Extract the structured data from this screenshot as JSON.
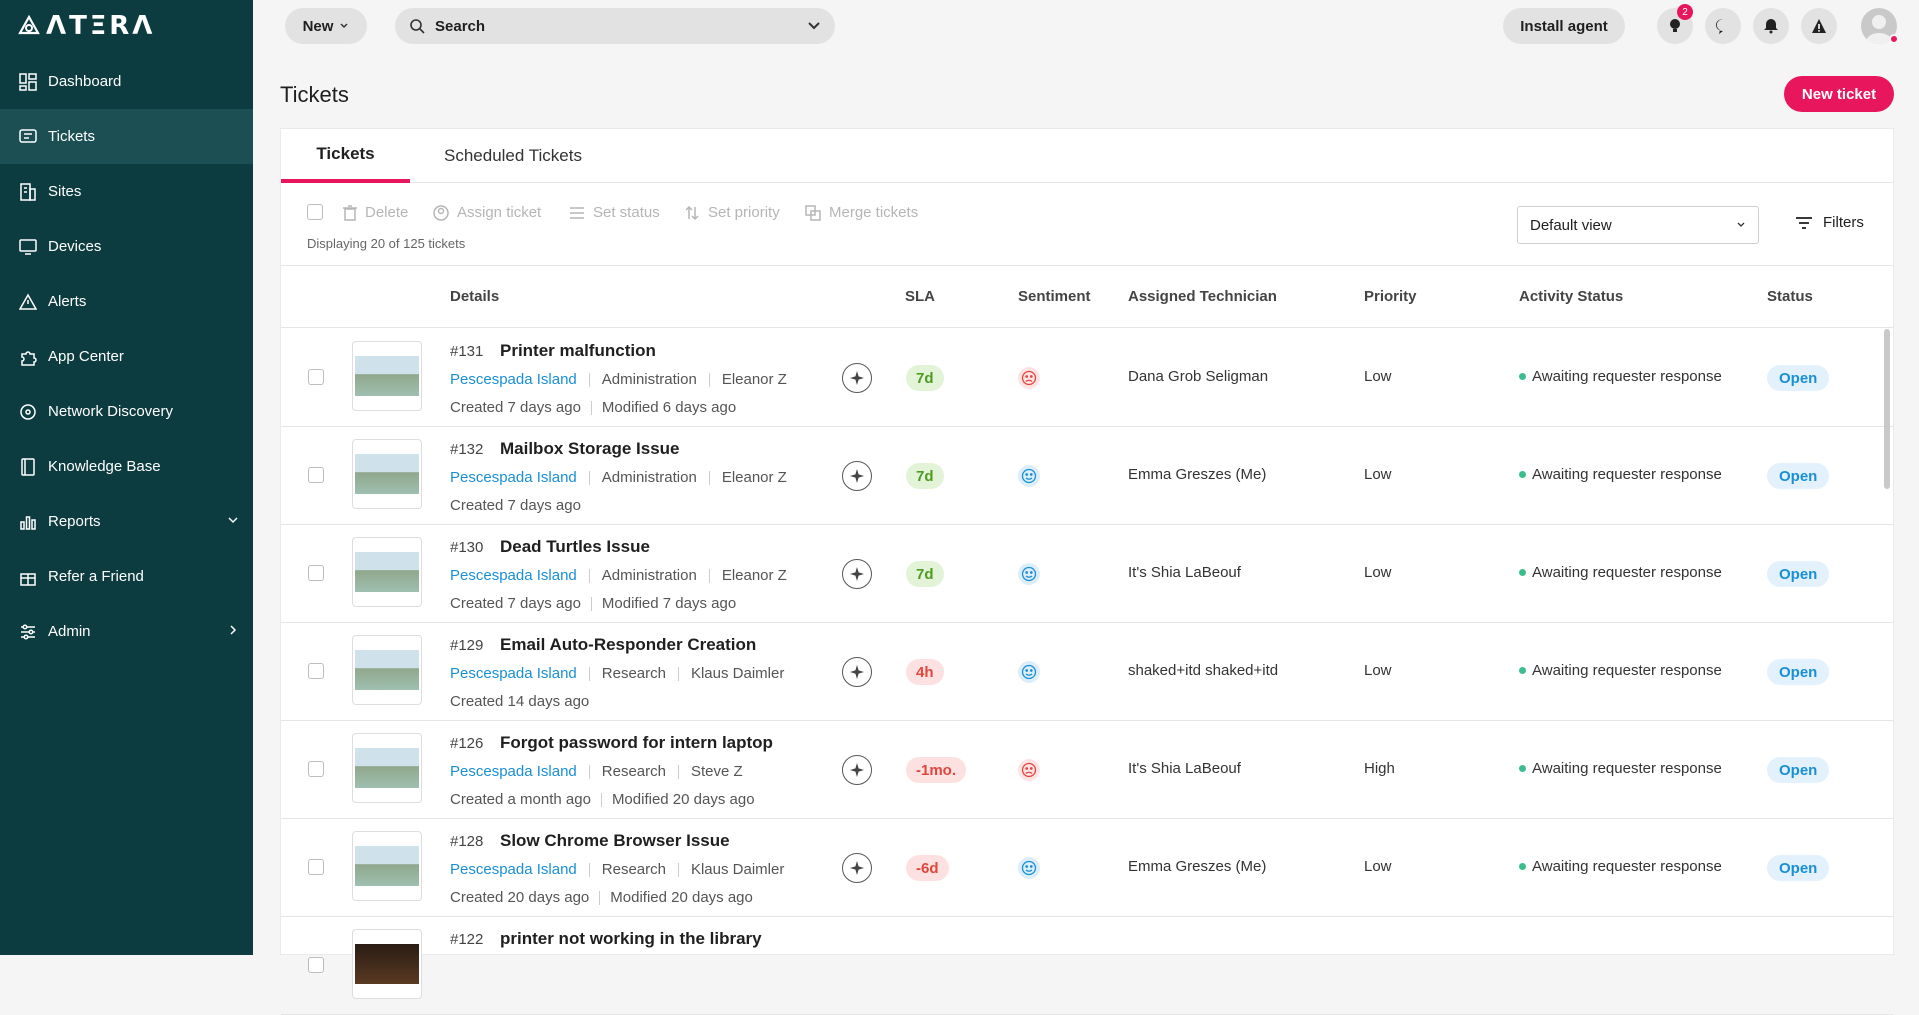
{
  "app": {
    "logo_text": "ΛΤΞRΛ"
  },
  "sidebar": {
    "items": [
      {
        "label": "Dashboard",
        "icon": "dashboard-icon"
      },
      {
        "label": "Tickets",
        "icon": "ticket-icon",
        "active": true
      },
      {
        "label": "Sites",
        "icon": "building-icon"
      },
      {
        "label": "Devices",
        "icon": "monitor-icon"
      },
      {
        "label": "Alerts",
        "icon": "warning-icon"
      },
      {
        "label": "App Center",
        "icon": "puzzle-icon"
      },
      {
        "label": "Network Discovery",
        "icon": "network-icon"
      },
      {
        "label": "Knowledge Base",
        "icon": "book-icon"
      },
      {
        "label": "Reports",
        "icon": "bar-chart-icon"
      },
      {
        "label": "Refer a Friend",
        "icon": "gift-icon"
      },
      {
        "label": "Admin",
        "icon": "sliders-icon"
      }
    ]
  },
  "topbar": {
    "new_label": "New",
    "search_label": "Search",
    "install_label": "Install agent",
    "notification_badge": "2"
  },
  "page": {
    "title": "Tickets",
    "new_ticket_label": "New ticket"
  },
  "tabs": [
    {
      "label": "Tickets"
    },
    {
      "label": "Scheduled Tickets"
    }
  ],
  "toolbar": {
    "delete": "Delete",
    "assign": "Assign ticket",
    "set_status": "Set status",
    "set_priority": "Set priority",
    "merge": "Merge tickets",
    "displaying": "Displaying 20 of 125 tickets",
    "view": "Default view",
    "filters": "Filters"
  },
  "columns": {
    "details": "Details",
    "sla": "SLA",
    "sentiment": "Sentiment",
    "technician": "Assigned Technician",
    "priority": "Priority",
    "activity": "Activity Status",
    "status": "Status"
  },
  "tickets": [
    {
      "num": "#131",
      "title": "Printer malfunction",
      "site": "Pescespada Island",
      "dept": "Administration",
      "user": "Eleanor Z",
      "created": "Created 7 days ago",
      "modified": "Modified 6 days ago",
      "sla": "7d",
      "sla_state": "ok",
      "sentiment": "sad",
      "tech": "Dana Grob Seligman",
      "priority": "Low",
      "activity": "Awaiting requester response",
      "status": "Open"
    },
    {
      "num": "#132",
      "title": "Mailbox Storage Issue",
      "site": "Pescespada Island",
      "dept": "Administration",
      "user": "Eleanor Z",
      "created": "Created 7 days ago",
      "modified": "",
      "sla": "7d",
      "sla_state": "ok",
      "sentiment": "neutral",
      "tech": "Emma Greszes (Me)",
      "priority": "Low",
      "activity": "Awaiting requester response",
      "status": "Open"
    },
    {
      "num": "#130",
      "title": "Dead Turtles Issue",
      "site": "Pescespada Island",
      "dept": "Administration",
      "user": "Eleanor Z",
      "created": "Created 7 days ago",
      "modified": "Modified 7 days ago",
      "sla": "7d",
      "sla_state": "ok",
      "sentiment": "neutral",
      "tech": "It's Shia LaBeouf",
      "priority": "Low",
      "activity": "Awaiting requester response",
      "status": "Open"
    },
    {
      "num": "#129",
      "title": "Email Auto-Responder Creation",
      "site": "Pescespada Island",
      "dept": "Research",
      "user": "Klaus Daimler",
      "created": "Created 14 days ago",
      "modified": "",
      "sla": "4h",
      "sla_state": "bad",
      "sentiment": "neutral",
      "tech": "shaked+itd shaked+itd",
      "priority": "Low",
      "activity": "Awaiting requester response",
      "status": "Open"
    },
    {
      "num": "#126",
      "title": "Forgot password for intern laptop",
      "site": "Pescespada Island",
      "dept": "Research",
      "user": "Steve Z",
      "created": "Created a month ago",
      "modified": "Modified 20 days ago",
      "sla": "-1mo.",
      "sla_state": "bad",
      "sentiment": "sad",
      "tech": "It's Shia LaBeouf",
      "priority": "High",
      "activity": "Awaiting requester response",
      "status": "Open"
    },
    {
      "num": "#128",
      "title": "Slow Chrome Browser Issue",
      "site": "Pescespada Island",
      "dept": "Research",
      "user": "Klaus Daimler",
      "created": "Created 20 days ago",
      "modified": "Modified 20 days ago",
      "sla": "-6d",
      "sla_state": "bad",
      "sentiment": "neutral",
      "tech": "Emma Greszes (Me)",
      "priority": "Low",
      "activity": "Awaiting requester response",
      "status": "Open"
    },
    {
      "num": "#122",
      "title": "printer not working in the library",
      "site": "",
      "dept": "",
      "user": "",
      "created": "",
      "modified": "",
      "sla": "",
      "sla_state": "ok",
      "sentiment": "neutral",
      "tech": "",
      "priority": "",
      "activity": "",
      "status": ""
    }
  ],
  "colors": {
    "accent": "#e8175d",
    "sidebar": "#0c3c40",
    "link": "#1a8fd6"
  }
}
